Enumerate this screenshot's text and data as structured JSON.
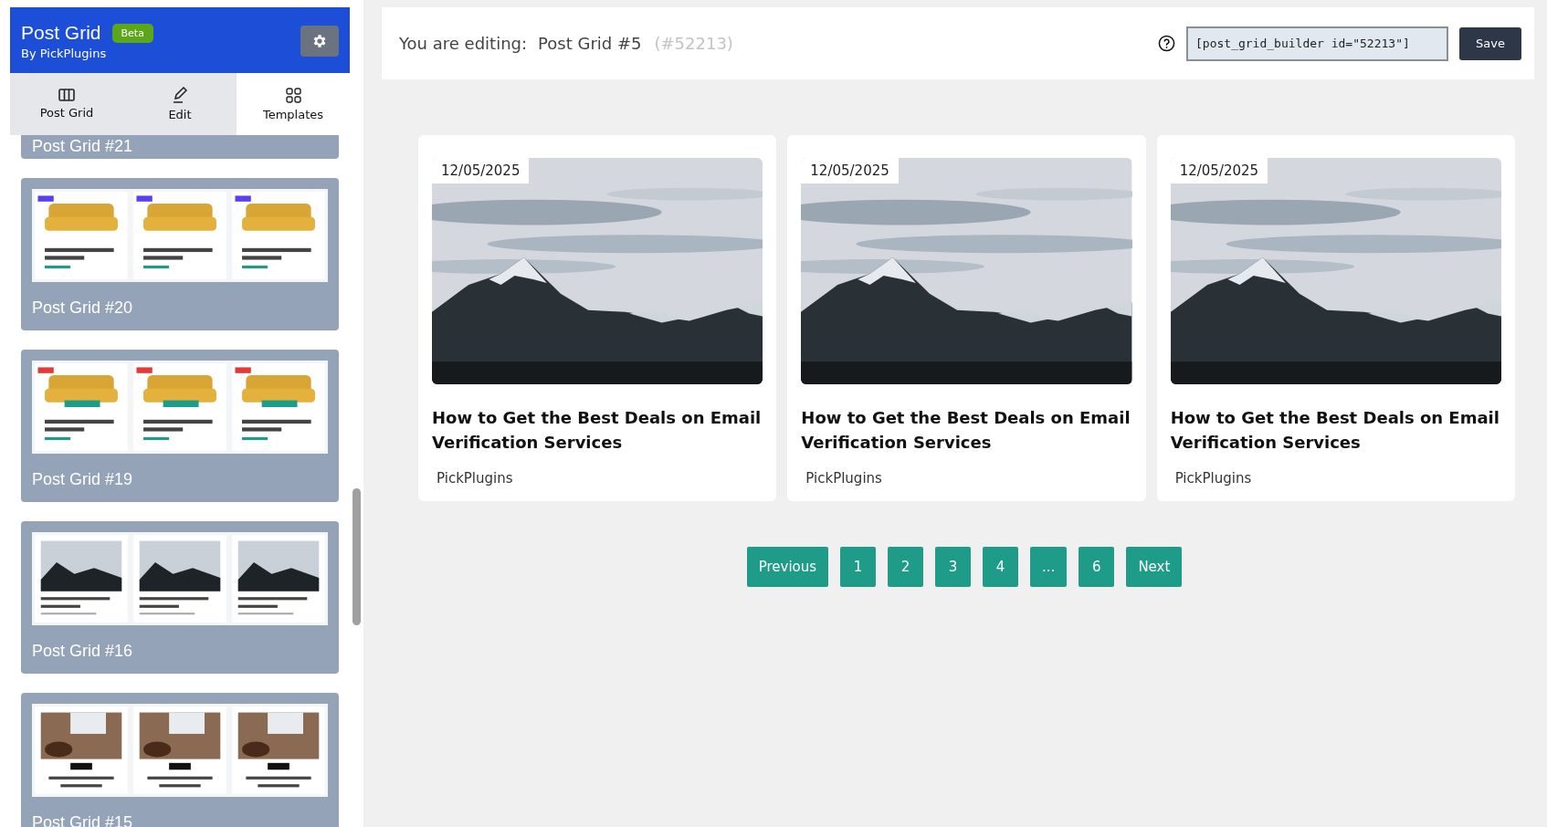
{
  "sidebar": {
    "app_title": "Post Grid",
    "badge": "Beta",
    "byline": "By PickPlugins",
    "tabs": [
      {
        "label": "Post Grid",
        "selected": false
      },
      {
        "label": "Edit",
        "selected": false
      },
      {
        "label": "Templates",
        "selected": true
      }
    ],
    "templates": [
      {
        "title": "Post Grid #21"
      },
      {
        "title": "Post Grid #20",
        "kind": "picture"
      },
      {
        "title": "Post Grid #19",
        "kind": "picture"
      },
      {
        "title": "Post Grid #16",
        "kind": "picture"
      },
      {
        "title": "Post Grid #15",
        "kind": "picture"
      }
    ]
  },
  "editor": {
    "label": "You are editing:",
    "post_name": "Post Grid #5",
    "post_id": "(#52213)",
    "shortcode": "[post_grid_builder id=\"52213\"]",
    "save_button": "Save"
  },
  "posts": [
    {
      "date": "12/05/2025",
      "title": "How to Get the Best Deals on Email Verification Services",
      "author": "PickPlugins",
      "kind": "picture"
    },
    {
      "date": "12/05/2025",
      "title": "How to Get the Best Deals on Email Verification Services",
      "author": "PickPlugins",
      "kind": "picture"
    },
    {
      "date": "12/05/2025",
      "title": "How to Get the Best Deals on Email Verification Services",
      "author": "PickPlugins",
      "kind": "picture"
    }
  ],
  "pagination": [
    "Previous",
    "1",
    "2",
    "3",
    "4",
    "...",
    "6",
    "Next"
  ]
}
